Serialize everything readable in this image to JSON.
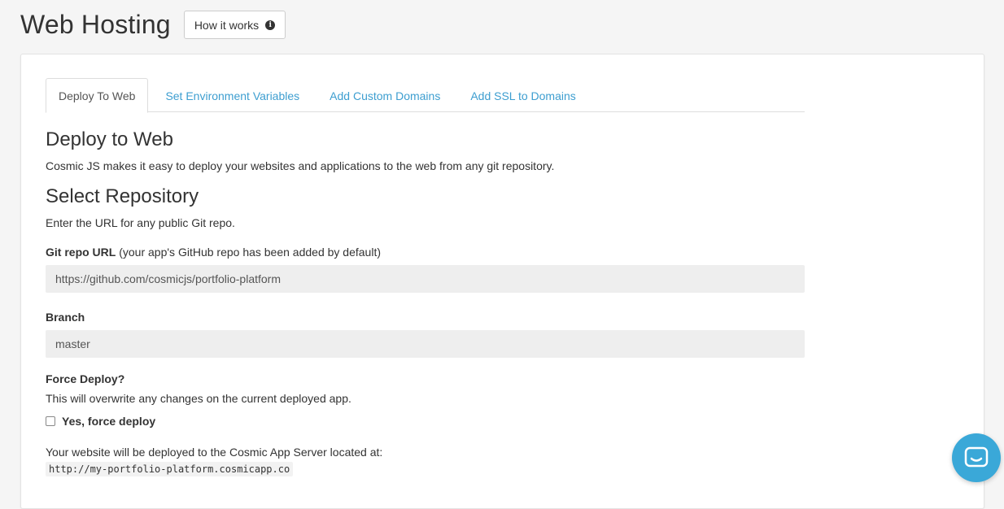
{
  "header": {
    "title": "Web Hosting",
    "how_it_works_label": "How it works",
    "info_glyph": "i"
  },
  "tabs": [
    {
      "label": "Deploy To Web",
      "active": true
    },
    {
      "label": "Set Environment Variables",
      "active": false
    },
    {
      "label": "Add Custom Domains",
      "active": false
    },
    {
      "label": "Add SSL to Domains",
      "active": false
    }
  ],
  "deploy": {
    "title": "Deploy to Web",
    "description": "Cosmic JS makes it easy to deploy your websites and applications to the web from any git repository."
  },
  "repository": {
    "title": "Select Repository",
    "description": "Enter the URL for any public Git repo.",
    "git_label": "Git repo URL",
    "git_hint": " (your app's GitHub repo has been added by default)",
    "git_value": "https://github.com/cosmicjs/portfolio-platform",
    "branch_label": "Branch",
    "branch_value": "master"
  },
  "force": {
    "label": "Force Deploy?",
    "description": "This will overwrite any changes on the current deployed app.",
    "checkbox_label": "Yes, force deploy",
    "checked": false
  },
  "server": {
    "note": "Your website will be deployed to the Cosmic App Server located at:",
    "url": "http://my-portfolio-platform.cosmicapp.co"
  },
  "colors": {
    "link": "#3d9ed0",
    "chat_launcher": "#3aa8d8"
  },
  "icons": {
    "info": "info-circle-icon",
    "chat": "chat-bubble-icon"
  }
}
